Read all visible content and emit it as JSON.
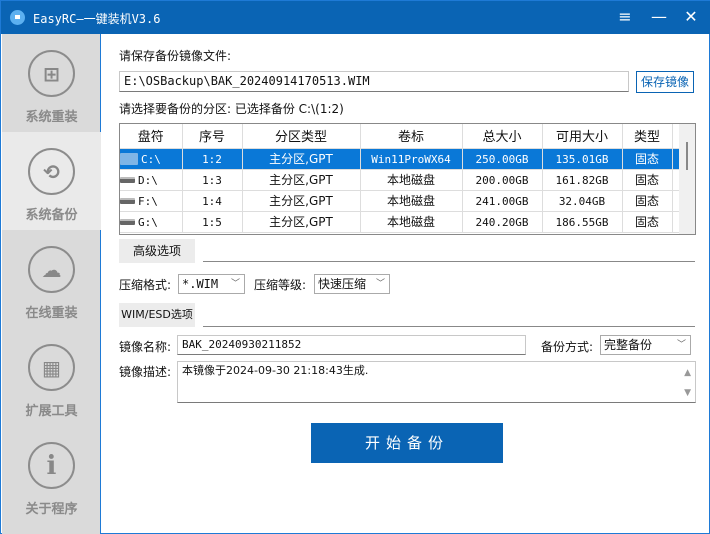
{
  "window": {
    "title": "EasyRC—一键装机V3.6",
    "menu_icon": "≡",
    "min_icon": "—",
    "close_icon": "✕"
  },
  "sidebar": {
    "items": [
      {
        "label": "系统重装",
        "icon": "windows-icon",
        "glyph": "⊞"
      },
      {
        "label": "系统备份",
        "icon": "backup-icon",
        "glyph": "⟲"
      },
      {
        "label": "在线重装",
        "icon": "cloud-sync-icon",
        "glyph": "☁"
      },
      {
        "label": "扩展工具",
        "icon": "tools-grid-icon",
        "glyph": "▦"
      },
      {
        "label": "关于程序",
        "icon": "info-icon",
        "glyph": "i"
      }
    ]
  },
  "save": {
    "label": "请保存备份镜像文件:",
    "path": "E:\\OSBackup\\BAK_20240914170513.WIM",
    "button": "保存镜像"
  },
  "partition": {
    "label": "请选择要备份的分区: 已选择备份 C:\\(1:2)",
    "columns": [
      "盘符",
      "序号",
      "分区类型",
      "卷标",
      "总大小",
      "可用大小",
      "类型"
    ],
    "rows": [
      [
        "C:\\",
        "1:2",
        "主分区,GPT",
        "Win11ProWX64",
        "250.00GB",
        "135.01GB",
        "固态"
      ],
      [
        "D:\\",
        "1:3",
        "主分区,GPT",
        "本地磁盘",
        "200.00GB",
        "161.82GB",
        "固态"
      ],
      [
        "F:\\",
        "1:4",
        "主分区,GPT",
        "本地磁盘",
        "241.00GB",
        "32.04GB",
        "固态"
      ],
      [
        "G:\\",
        "1:5",
        "主分区,GPT",
        "本地磁盘",
        "240.20GB",
        "186.55GB",
        "固态"
      ]
    ],
    "selected_row": 0
  },
  "advanced": {
    "tab": "高级选项",
    "format_label": "压缩格式:",
    "format_value": "*.WIM",
    "level_label": "压缩等级:",
    "level_value": "快速压缩"
  },
  "wim": {
    "tab": "WIM/ESD选项",
    "name_label": "镜像名称:",
    "name_value": "BAK_20240930211852",
    "mode_label": "备份方式:",
    "mode_value": "完整备份",
    "desc_label": "镜像描述:",
    "desc_value": "本镜像于2024-09-30 21:18:43生成."
  },
  "start_button": "开始备份",
  "colors": {
    "accent": "#0a64b4",
    "selected_row": "#0a78d7",
    "sidebar_bg": "#dadada",
    "sidebar_active": "#eaeaea"
  }
}
